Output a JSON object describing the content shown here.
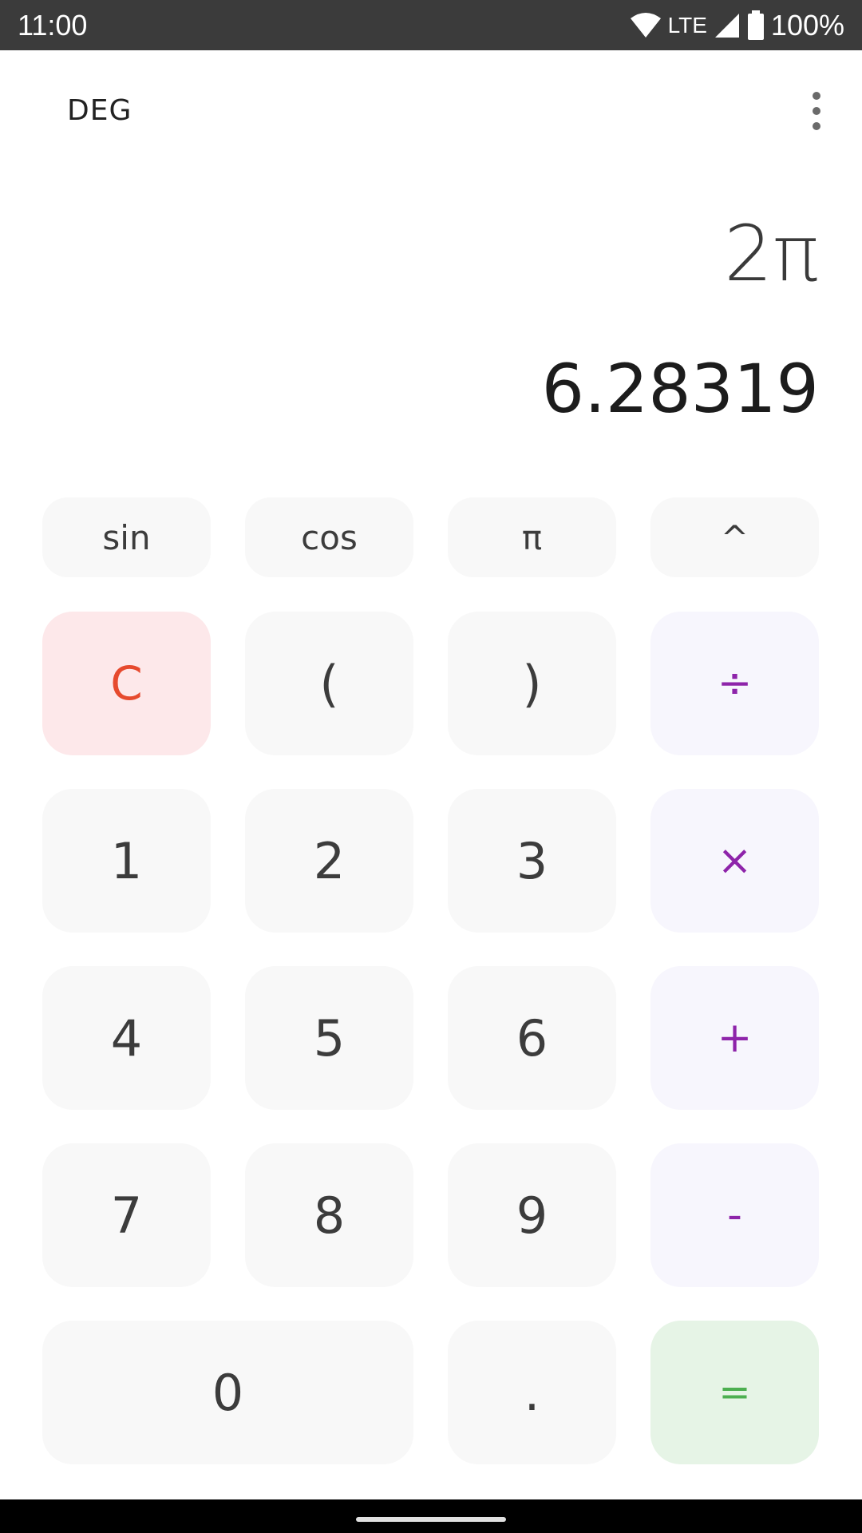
{
  "status_bar": {
    "time": "11:00",
    "network": "LTE",
    "battery": "100%"
  },
  "header": {
    "angle_mode": "DEG",
    "menu_icon": "more-vert-icon"
  },
  "display": {
    "expression": "2π",
    "result": "6.28319"
  },
  "function_row": [
    "sin",
    "cos",
    "π",
    "^"
  ],
  "keypad": {
    "clear": "C",
    "open_paren": "(",
    "close_paren": ")",
    "divide": "÷",
    "one": "1",
    "two": "2",
    "three": "3",
    "multiply": "×",
    "four": "4",
    "five": "5",
    "six": "6",
    "plus": "+",
    "seven": "7",
    "eight": "8",
    "nine": "9",
    "minus": "-",
    "zero": "0",
    "decimal": ".",
    "equals": "="
  },
  "colors": {
    "operator": "#8e24aa",
    "clear": "#e64a2e",
    "clear_bg": "#fde8ea",
    "equals": "#4caf50",
    "equals_bg": "#e6f4e6",
    "key_bg": "#f8f8f8",
    "status_bar_bg": "#3b3b3b"
  }
}
